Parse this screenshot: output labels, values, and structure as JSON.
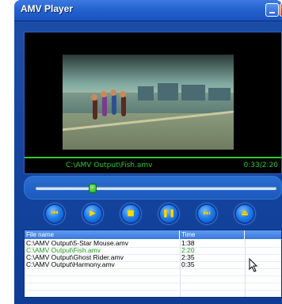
{
  "window": {
    "title": "AMV Player"
  },
  "video": {
    "file_path": "C:\\AMV Output\\Fish.amv",
    "time": "0:33/2:20"
  },
  "seek": {
    "progress": 0.236
  },
  "controls": [
    {
      "name": "previous-button",
      "icon": "previous-icon",
      "glyph": "⏮"
    },
    {
      "name": "play-button",
      "icon": "play-icon",
      "glyph": "▶"
    },
    {
      "name": "stop-button",
      "icon": "stop-icon",
      "glyph": "■"
    },
    {
      "name": "pause-button",
      "icon": "pause-icon",
      "glyph": "❚❚"
    },
    {
      "name": "next-button",
      "icon": "next-icon",
      "glyph": "⏭"
    },
    {
      "name": "eject-button",
      "icon": "eject-icon",
      "glyph": "⏏"
    }
  ],
  "playlist": {
    "columns": [
      "File name",
      "Time"
    ],
    "rows": [
      {
        "file": "C:\\AMV Output\\5-Star Mouse.amv",
        "time": "1:38",
        "active": false
      },
      {
        "file": "C:\\AMV Output\\Fish.amv",
        "time": "2:20",
        "active": true
      },
      {
        "file": "C:\\AMV Output\\Ghost Rider.amv",
        "time": "2:35",
        "active": false
      },
      {
        "file": "C:\\AMV Output\\Harmony.amv",
        "time": "0:35",
        "active": false
      }
    ]
  },
  "colors": {
    "accent_green": "#33c72e",
    "active_row_text": "#1f9a1a",
    "window_blue": "#1646a0",
    "button_glyph_yellow": "#ffd900"
  }
}
